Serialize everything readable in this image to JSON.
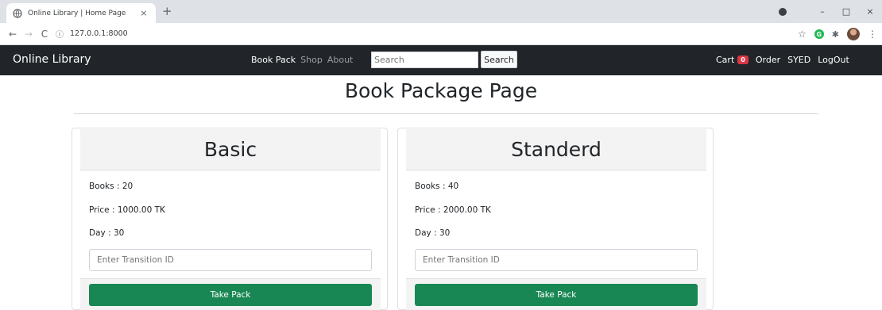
{
  "browser": {
    "tab_title": "Online Library | Home Page",
    "tab_close": "×",
    "new_tab": "+",
    "url": "127.0.0.1:8000",
    "window_controls": [
      "–",
      "□",
      "×"
    ]
  },
  "navbar": {
    "brand": "Online Library",
    "links": [
      "Book Pack",
      "Shop",
      "About"
    ],
    "search_placeholder": "Search",
    "search_button": "Search",
    "cart_label": "Cart",
    "cart_count": "0",
    "order": "Order",
    "user": "SYED",
    "logout": "LogOut"
  },
  "page": {
    "title": "Book Package Page"
  },
  "packages": [
    {
      "name": "Basic",
      "books": "Books : 20",
      "price": "Price : 1000.00 TK",
      "day": "Day : 30",
      "input_placeholder": "Enter Transition ID",
      "button": "Take Pack"
    },
    {
      "name": "Standerd",
      "books": "Books : 40",
      "price": "Price : 2000.00 TK",
      "day": "Day : 30",
      "input_placeholder": "Enter Transition ID",
      "button": "Take Pack"
    }
  ],
  "colors": {
    "navbar_bg": "#212529",
    "button_green": "#198754",
    "badge_red": "#dc3545"
  }
}
